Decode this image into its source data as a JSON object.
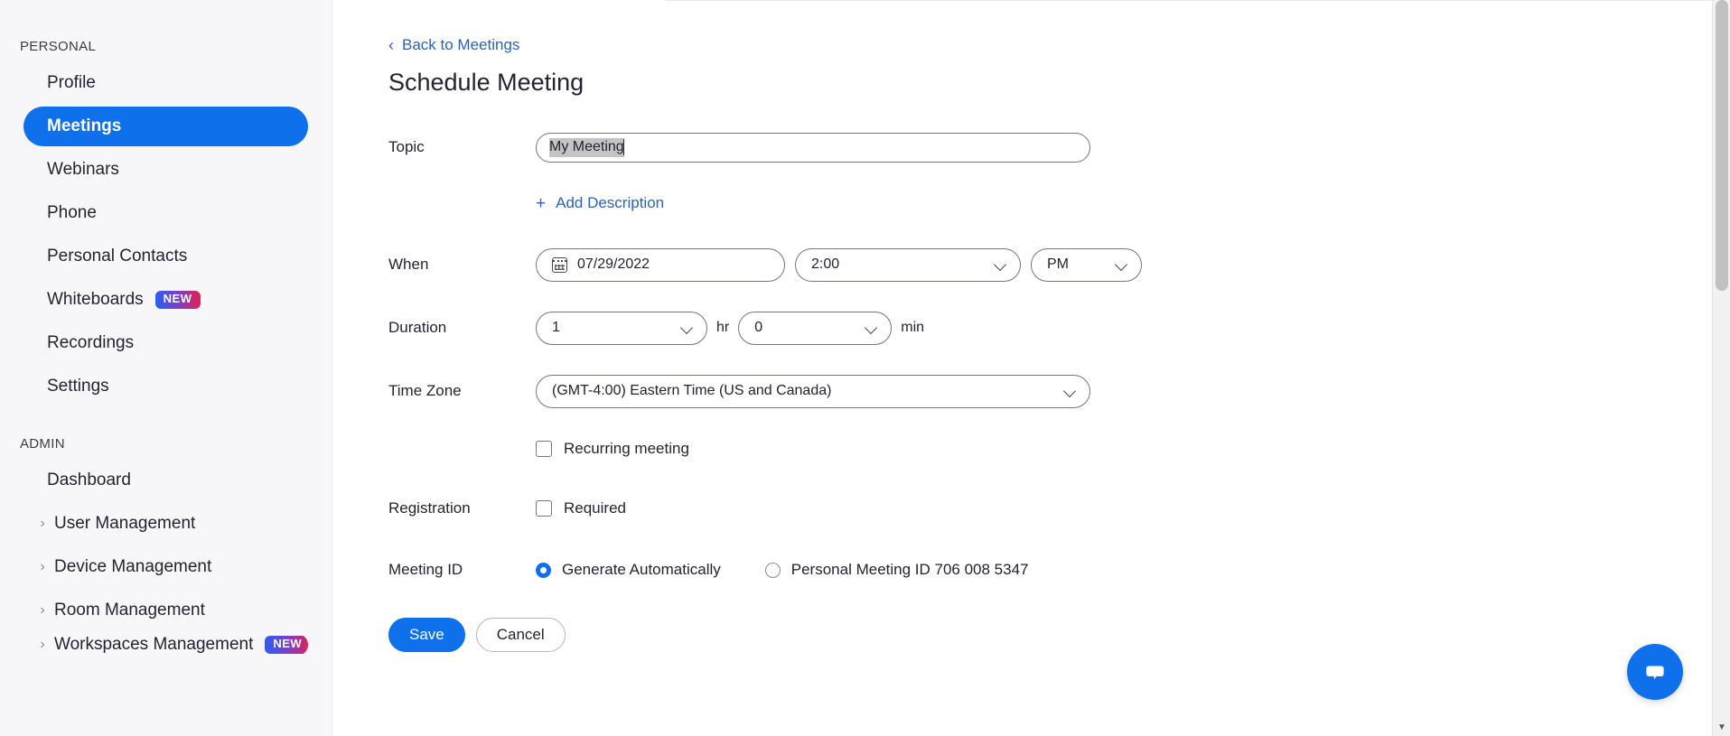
{
  "sidebar": {
    "sections": [
      {
        "label": "PERSONAL",
        "items": [
          {
            "label": "Profile",
            "active": false,
            "caret": false
          },
          {
            "label": "Meetings",
            "active": true,
            "caret": false
          },
          {
            "label": "Webinars",
            "active": false,
            "caret": false
          },
          {
            "label": "Phone",
            "active": false,
            "caret": false
          },
          {
            "label": "Personal Contacts",
            "active": false,
            "caret": false
          },
          {
            "label": "Whiteboards",
            "active": false,
            "caret": false,
            "badge": "NEW"
          },
          {
            "label": "Recordings",
            "active": false,
            "caret": false
          },
          {
            "label": "Settings",
            "active": false,
            "caret": false
          }
        ]
      },
      {
        "label": "ADMIN",
        "items": [
          {
            "label": "Dashboard",
            "active": false,
            "caret": false
          },
          {
            "label": "User Management",
            "active": false,
            "caret": true
          },
          {
            "label": "Device Management",
            "active": false,
            "caret": true
          },
          {
            "label": "Room Management",
            "active": false,
            "caret": true
          },
          {
            "label": "Workspaces Management",
            "active": false,
            "caret": true,
            "badge": "NEW"
          }
        ]
      }
    ]
  },
  "main": {
    "back_link": "Back to Meetings",
    "page_title": "Schedule Meeting",
    "topic": {
      "label": "Topic",
      "value": "My Meeting",
      "selected": true
    },
    "add_description": "Add Description",
    "when": {
      "label": "When",
      "date": "07/29/2022",
      "time": "2:00",
      "meridiem": "PM"
    },
    "duration": {
      "label": "Duration",
      "hours": "1",
      "hours_unit": "hr",
      "minutes": "0",
      "minutes_unit": "min"
    },
    "timezone": {
      "label": "Time Zone",
      "value": "(GMT-4:00) Eastern Time (US and Canada)"
    },
    "recurring": {
      "label": "Recurring meeting",
      "checked": false
    },
    "registration": {
      "label": "Registration",
      "option_label": "Required",
      "checked": false
    },
    "meeting_id": {
      "label": "Meeting ID",
      "option_auto": "Generate Automatically",
      "option_personal": "Personal Meeting ID 706 008 5347",
      "selected": "auto"
    },
    "actions": {
      "save": "Save",
      "cancel": "Cancel"
    }
  },
  "chat_fab": {
    "icon": "chat-bubble-icon"
  },
  "scrollbar": {
    "arrow": "▼"
  },
  "colors": {
    "accent": "#0e71eb",
    "link": "#2D62B5",
    "sidebar_bg": "#f7f7f9",
    "text": "#232333",
    "selection": "#c4c4c4"
  }
}
